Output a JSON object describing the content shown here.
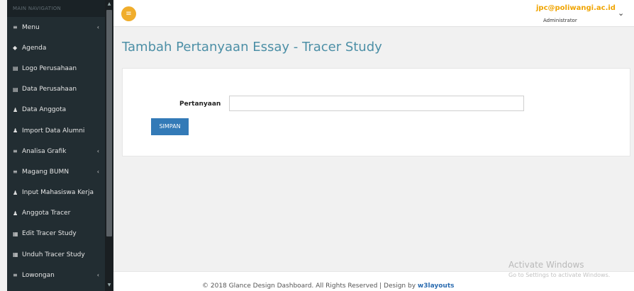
{
  "sidebar": {
    "header": "MAIN NAVIGATION",
    "items": [
      {
        "icon": "bars-icon",
        "glyph": "≡",
        "label": "Menu",
        "has_chevron": true
      },
      {
        "icon": "tag-icon",
        "glyph": "◆",
        "label": "Agenda",
        "has_chevron": false
      },
      {
        "icon": "file-icon",
        "glyph": "▤",
        "label": "Logo Perusahaan",
        "has_chevron": false
      },
      {
        "icon": "file-icon",
        "glyph": "▤",
        "label": "Data Perusahaan",
        "has_chevron": false
      },
      {
        "icon": "user-icon",
        "glyph": "♟",
        "label": "Data Anggota",
        "has_chevron": false
      },
      {
        "icon": "user-icon",
        "glyph": "♟",
        "label": "Import Data Alumni",
        "has_chevron": false
      },
      {
        "icon": "bars-icon",
        "glyph": "≡",
        "label": "Analisa Grafik",
        "has_chevron": true
      },
      {
        "icon": "bars-icon",
        "glyph": "≡",
        "label": "Magang BUMN",
        "has_chevron": true
      },
      {
        "icon": "user-icon",
        "glyph": "♟",
        "label": "Input Mahasiswa Kerja",
        "has_chevron": false
      },
      {
        "icon": "user-icon",
        "glyph": "♟",
        "label": "Anggota Tracer",
        "has_chevron": false
      },
      {
        "icon": "card-icon",
        "glyph": "▦",
        "label": "Edit Tracer Study",
        "has_chevron": false
      },
      {
        "icon": "card-icon",
        "glyph": "▦",
        "label": "Unduh Tracer Study",
        "has_chevron": false
      },
      {
        "icon": "bars-icon",
        "glyph": "≡",
        "label": "Lowongan",
        "has_chevron": true
      }
    ],
    "chevron_glyph": "‹"
  },
  "topbar": {
    "toggle_glyph": "≡",
    "user_email": "jpc@poliwangi.ac.id",
    "user_role": "Administrator",
    "caret_glyph": "⌄"
  },
  "page": {
    "title": "Tambah Pertanyaan Essay - Tracer Study"
  },
  "form": {
    "label": "Pertanyaan",
    "input_value": "",
    "input_placeholder": "",
    "submit_label": "SIMPAN"
  },
  "footer": {
    "text": "© 2018 Glance Design Dashboard. All Rights Reserved | Design by ",
    "link": "w3layouts"
  },
  "watermark": {
    "title": "Activate Windows",
    "subtitle": "Go to Settings to activate Windows."
  },
  "colors": {
    "sidebar_bg": "#222d32",
    "accent_orange": "#f0ad2c",
    "title_blue": "#4c8fa6",
    "button_blue": "#337ab7"
  }
}
